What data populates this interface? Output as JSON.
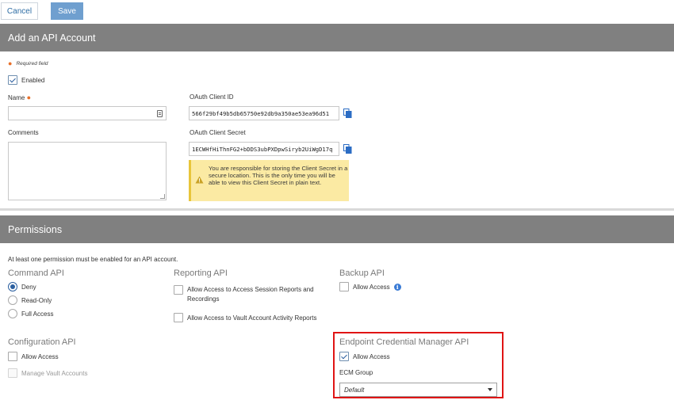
{
  "toolbar": {
    "cancel_label": "Cancel",
    "save_label": "Save"
  },
  "account": {
    "header": "Add an API Account",
    "required_note": "Required field",
    "enabled_label": "Enabled",
    "enabled_checked": true,
    "name_label": "Name",
    "comments_label": "Comments",
    "client_id_label": "OAuth Client ID",
    "client_id_value": "566f29bf49b5db65750e92db9a350ae53ea96d51",
    "client_secret_label": "OAuth Client Secret",
    "client_secret_value": "1ECWHfHiThnFG2+bDDS3ubPXDpwSiryb2UiWgD17q",
    "warning_text": "You are responsible for storing the Client Secret in a secure location. This is the only time you will be able to view this Client Secret in plain text."
  },
  "permissions": {
    "header": "Permissions",
    "note": "At least one permission must be enabled for an API account.",
    "command": {
      "title": "Command API",
      "options": [
        "Deny",
        "Read-Only",
        "Full Access"
      ],
      "selected": "Deny"
    },
    "reporting": {
      "title": "Reporting API",
      "opt1": "Allow Access to Access Session Reports and",
      "opt1_line2": "Recordings",
      "opt2": "Allow Access to Vault Account Activity Reports"
    },
    "backup": {
      "title": "Backup API",
      "allow_label": "Allow Access"
    },
    "configuration": {
      "title": "Configuration API",
      "allow_label": "Allow Access",
      "vault_label": "Manage Vault Accounts"
    },
    "ecm": {
      "title": "Endpoint Credential Manager API",
      "allow_label": "Allow Access",
      "allow_checked": true,
      "group_label": "ECM Group",
      "group_value": "Default"
    }
  },
  "colors": {
    "header_bg": "#808080",
    "accent": "#2b5fa0",
    "highlight": "#e01414",
    "warning_bg": "#fbeaa3"
  }
}
